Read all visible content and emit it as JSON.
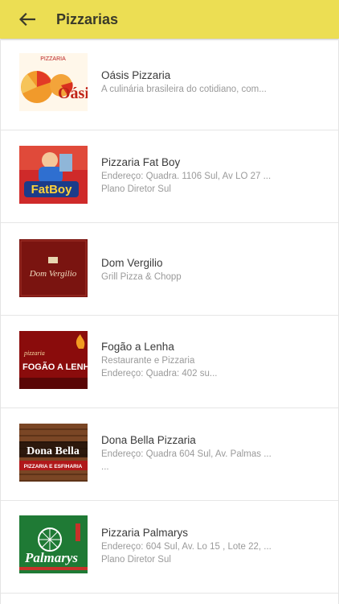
{
  "appbar": {
    "title": "Pizzarias",
    "back_icon": "arrow-left-icon",
    "background": "#ecde53"
  },
  "restaurants": [
    {
      "name": "Oásis Pizzaria",
      "lines": [
        "A culinária brasileira do cotidiano, com..."
      ],
      "logo_text": "PIZZARIA",
      "logo_word": "Oásis"
    },
    {
      "name": "Pizzaria Fat Boy",
      "lines": [
        "Endereço: Quadra. 1106 Sul, Av LO 27 ...",
        "Plano Diretor Sul"
      ],
      "logo_text": "FatBoy",
      "logo_word": "FatBoy"
    },
    {
      "name": "Dom Vergilio",
      "lines": [
        "Grill Pizza & Chopp"
      ],
      "logo_text": "Dom Vergilio",
      "logo_word": "Dom Vergilio"
    },
    {
      "name": "Fogão a Lenha",
      "lines": [
        "Restaurante e Pizzaria",
        "Endereço: Quadra: 402 su..."
      ],
      "logo_text": "pizzaria",
      "logo_word": "FOGÃO A LENHA"
    },
    {
      "name": "Dona Bella Pizzaria",
      "lines": [
        "Endereço: Quadra 604 Sul, Av. Palmas ...",
        "..."
      ],
      "logo_text": "Dona Bella",
      "logo_word": "PIZZARIA E ESFIHARIA"
    },
    {
      "name": "Pizzaria Palmarys",
      "lines": [
        "Endereço: 604 Sul, Av. Lo 15 , Lote 22, ...",
        "Plano Diretor Sul"
      ],
      "logo_text": "Palmarys",
      "logo_word": "Palmarys"
    }
  ]
}
